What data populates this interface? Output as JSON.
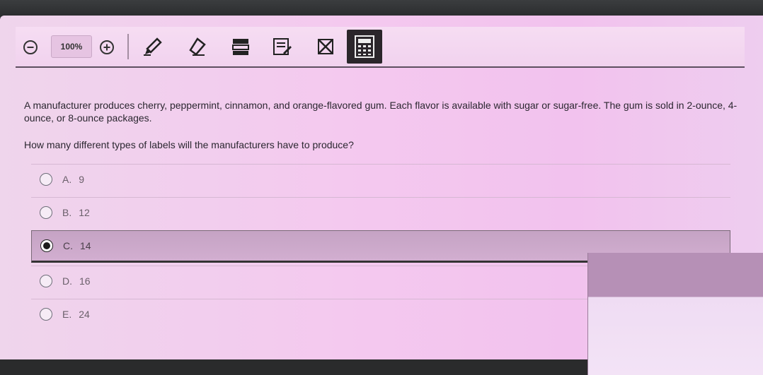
{
  "toolbar": {
    "zoom_level": "100%",
    "icons": [
      "zoom-out-icon",
      "zoom-in-icon",
      "pencil-icon",
      "eraser-icon",
      "highlighter-icon",
      "notes-icon",
      "answer-eliminator-icon",
      "calculator-icon"
    ]
  },
  "question": {
    "text": "A manufacturer produces cherry, peppermint, cinnamon, and orange-flavored gum. Each flavor is available with sugar or sugar-free. The gum is sold in 2-ounce, 4-ounce, or 8-ounce packages.",
    "prompt": "How many different types of labels will the manufacturers have to produce?"
  },
  "choices": [
    {
      "letter": "A.",
      "value": "9",
      "selected": false
    },
    {
      "letter": "B.",
      "value": "12",
      "selected": false
    },
    {
      "letter": "C.",
      "value": "14",
      "selected": true
    },
    {
      "letter": "D.",
      "value": "16",
      "selected": false
    },
    {
      "letter": "E.",
      "value": "24",
      "selected": false
    }
  ],
  "colors": {
    "selected_bg": "#c5a3c4",
    "page_bg": "#f4c9ef"
  }
}
